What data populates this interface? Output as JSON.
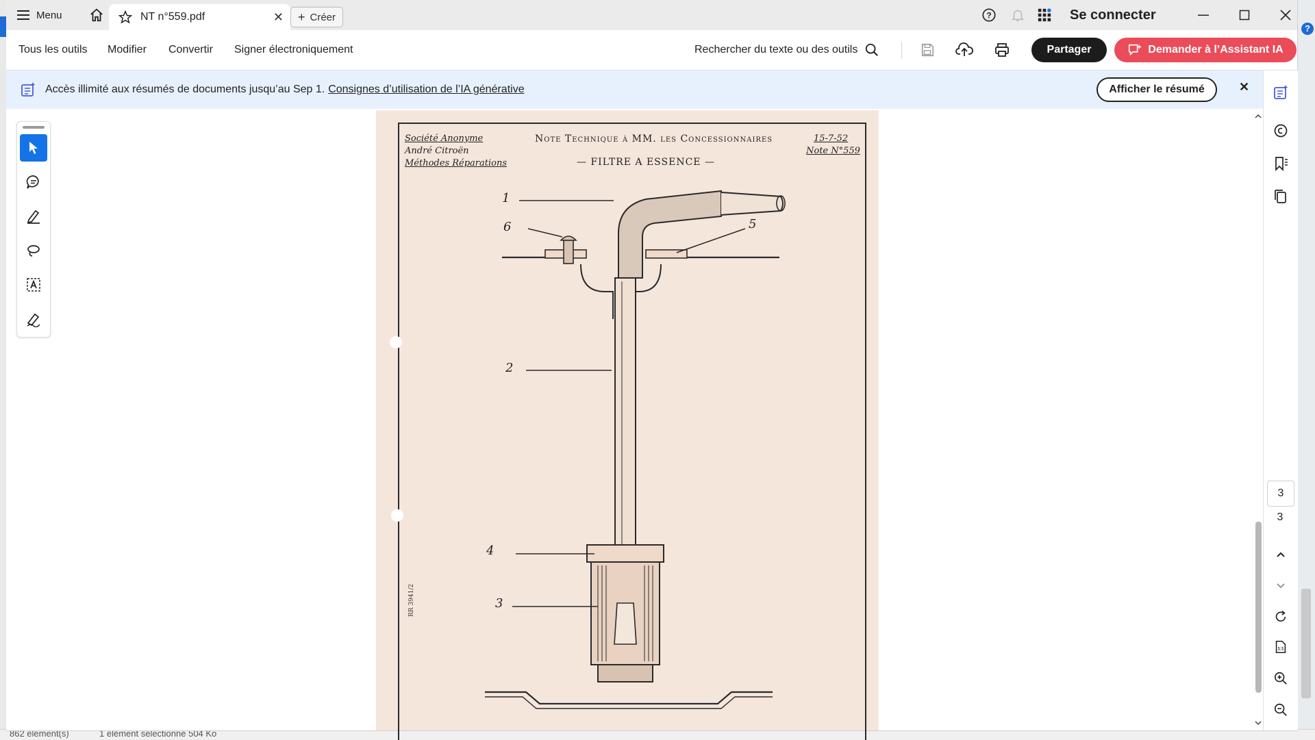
{
  "window": {
    "menu_label": "Menu",
    "tab_title": "NT n°559.pdf",
    "create_label": "Créer",
    "login_label": "Se connecter"
  },
  "toolbar": {
    "items": [
      "Tous les outils",
      "Modifier",
      "Convertir",
      "Signer électroniquement"
    ],
    "search_label": "Rechercher du texte ou des outils",
    "share_label": "Partager",
    "ai_label": "Demander à l’Assistant IA"
  },
  "banner": {
    "text": "Accès illimité aux résumés de documents jusqu’au Sep 1.",
    "link": "Consignes d’utilisation de l’IA générative",
    "summary_button": "Afficher le résumé"
  },
  "document": {
    "header_left": [
      "Société Anonyme",
      "André Citroën",
      "Méthodes Réparations"
    ],
    "header_center": "Note Technique à MM. les Concessionnaires",
    "header_date": "15-7-52",
    "header_note": "Note N°559",
    "title": "— FILTRE A ESSENCE —",
    "callouts": [
      "1",
      "2",
      "3",
      "4",
      "5",
      "6"
    ],
    "margin_ref": "RR 3941/2"
  },
  "navigator": {
    "current_page": "3",
    "total_pages": "3"
  },
  "statusbar": {
    "count": "862 élément(s)",
    "selection": "1 élément sélectionné  504 Ko"
  },
  "colors": {
    "accent": "#1473e6",
    "ai_button": "#ea4c59",
    "banner_bg": "#e7f1fd",
    "page_paper": "#f5e6dc"
  }
}
